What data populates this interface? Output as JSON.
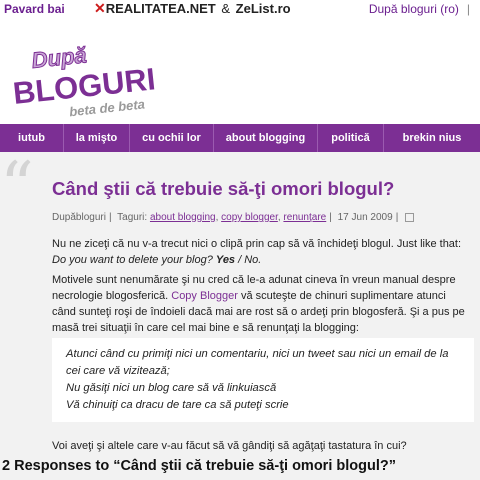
{
  "topbar": {
    "left": "Pavard bai",
    "realitatea": "REALITATEA.NET",
    "amp": "&",
    "zelist": "ZeList.ro",
    "right": "După bloguri (ro)",
    "right_sep": "|"
  },
  "logo": {
    "line1": "După",
    "line2": "BLOGURI",
    "line3": "beta de beta"
  },
  "nav": {
    "items": [
      {
        "label": "iutub"
      },
      {
        "label": "la mişto"
      },
      {
        "label": "cu ochii lor"
      },
      {
        "label": "about blogging"
      },
      {
        "label": "politică"
      },
      {
        "label": "brekin nius"
      }
    ]
  },
  "post": {
    "title": "Când ştii că trebuie să-ţi omori blogul?",
    "author": "Dupăbloguri",
    "tags_label": "Taguri:",
    "tags": [
      "about blogging",
      "copy blogger",
      "renunţare"
    ],
    "date": "17 Jun 2009",
    "p1_text": "Nu ne ziceţi că nu v-a trecut nici o clipă prin cap să vă închideţi blogul. Just like that: ",
    "p1_italic": "Do you want to delete your blog? ",
    "p1_bold": "Yes",
    "p1_end": " / No.",
    "p2_before": "Motivele sunt nenumărate şi nu cred că le-a adunat cineva în vreun manual despre necrologie blogosferică. ",
    "p2_link": "Copy Blogger",
    "p2_after": " vă scuteşte de chinuri suplimentare atunci când sunteţi roşi de îndoieli dacă mai are rost să o ardeţi prin blogosferă. Şi a pus pe masă trei situaţii în care cel mai bine e să renunţaţi la blogging:",
    "quote": [
      "Atunci când cu primiţi nici un comentariu, nici un tweet sau nici un email de la cei care vă vizitează;",
      "Nu găsiţi nici un blog care să vă linkuiască",
      "Vă chinuiţi ca dracu de tare ca să puteţi scrie"
    ],
    "p3": "Voi aveţi şi altele care v-au făcut să vă gândiţi să agăţaţi tastatura în cui?"
  },
  "responses": {
    "heading": "2 Responses to “Când ştii că trebuie să-ţi omori blogul?”"
  },
  "colors": {
    "accent": "#7c2f94",
    "nav_bg": "#7c2f94",
    "content_bg": "#f2f2f2",
    "realitatea_x": "#cc1b1b"
  }
}
